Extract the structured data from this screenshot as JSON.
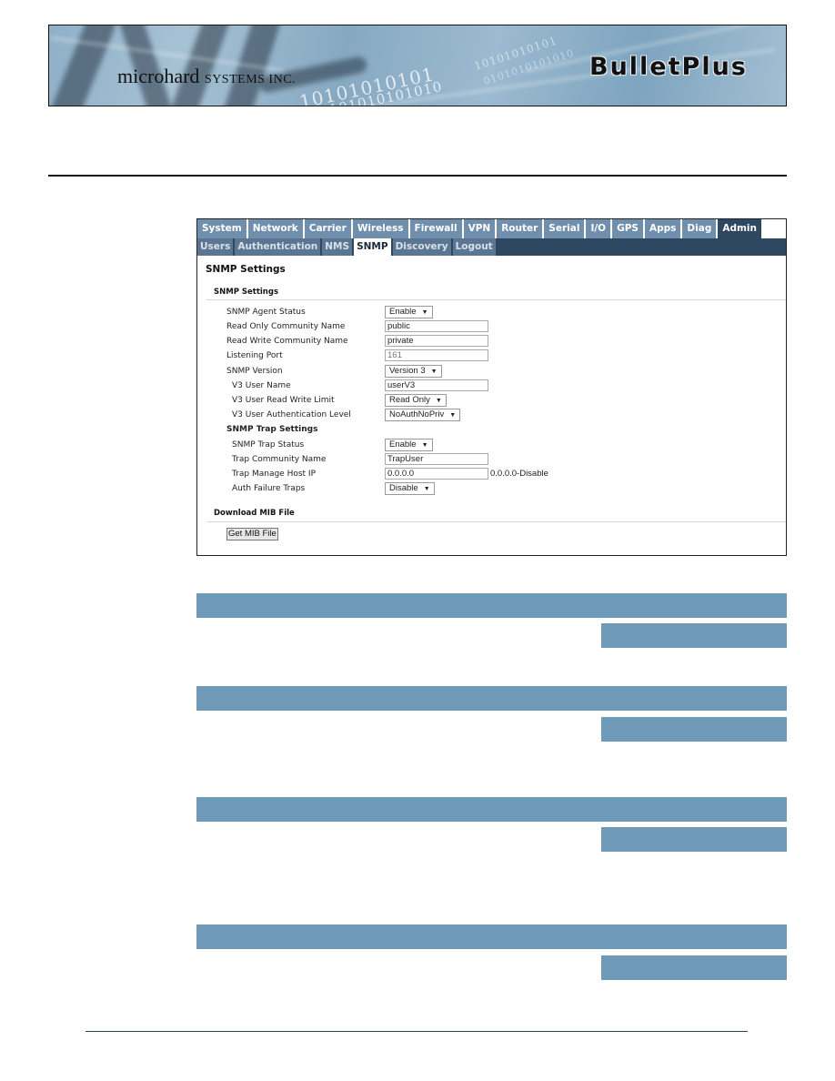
{
  "banner": {
    "brand": "microhard",
    "brand_suffix": "SYSTEMS INC.",
    "product": "BulletPlus",
    "binary_lines": [
      "10101010101",
      "0101010101010",
      "10101010101",
      "0101010101010"
    ]
  },
  "nav": {
    "main_tabs": [
      {
        "label": "System",
        "active": false
      },
      {
        "label": "Network",
        "active": false
      },
      {
        "label": "Carrier",
        "active": false
      },
      {
        "label": "Wireless",
        "active": false
      },
      {
        "label": "Firewall",
        "active": false
      },
      {
        "label": "VPN",
        "active": false
      },
      {
        "label": "Router",
        "active": false
      },
      {
        "label": "Serial",
        "active": false
      },
      {
        "label": "I/O",
        "active": false
      },
      {
        "label": "GPS",
        "active": false
      },
      {
        "label": "Apps",
        "active": false
      },
      {
        "label": "Diag",
        "active": false
      },
      {
        "label": "Admin",
        "active": true
      }
    ],
    "sub_tabs": [
      {
        "label": "Users",
        "active": false
      },
      {
        "label": "Authentication",
        "active": false
      },
      {
        "label": "NMS",
        "active": false
      },
      {
        "label": "SNMP",
        "active": true
      },
      {
        "label": "Discovery",
        "active": false
      },
      {
        "label": "Logout",
        "active": false
      }
    ]
  },
  "page": {
    "title": "SNMP Settings",
    "section_settings": "SNMP Settings",
    "fields": {
      "agent_status": {
        "label": "SNMP Agent Status",
        "value": "Enable"
      },
      "ro_community": {
        "label": "Read Only Community Name",
        "value": "public"
      },
      "rw_community": {
        "label": "Read Write Community Name",
        "value": "private"
      },
      "listening_port": {
        "label": "Listening Port",
        "value": "161"
      },
      "snmp_version": {
        "label": "SNMP Version",
        "value": "Version 3"
      },
      "v3_user_name": {
        "label": "V3 User Name",
        "value": "userV3"
      },
      "v3_rw_limit": {
        "label": "V3 User Read Write Limit",
        "value": "Read Only"
      },
      "v3_auth_level": {
        "label": "V3 User Authentication Level",
        "value": "NoAuthNoPriv"
      },
      "trap_heading": {
        "label": "SNMP Trap Settings"
      },
      "trap_status": {
        "label": "SNMP Trap Status",
        "value": "Enable"
      },
      "trap_community": {
        "label": "Trap Community Name",
        "value": "TrapUser"
      },
      "trap_host_ip": {
        "label": "Trap Manage Host IP",
        "value": "0.0.0.0",
        "hint": "0.0.0.0-Disable"
      },
      "auth_failure_traps": {
        "label": "Auth Failure Traps",
        "value": "Disable"
      }
    },
    "section_mib": "Download MIB File",
    "mib_button": "Get MIB File",
    "dropdown_arrow": "▼"
  },
  "colors": {
    "accent_bar": "#6e9ab8",
    "tab_active_dark": "#2e4862",
    "tab_inactive": "#6f8fad"
  }
}
